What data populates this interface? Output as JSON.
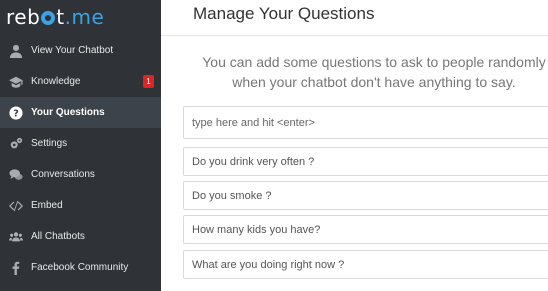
{
  "logo": {
    "part1": "reb",
    "part2": "t",
    "part3": ".me"
  },
  "sidebar": {
    "items": [
      {
        "label": "View Your Chatbot",
        "icon": "user-icon"
      },
      {
        "label": "Knowledge",
        "icon": "graduation-cap-icon",
        "badge": "1"
      },
      {
        "label": "Your Questions",
        "icon": "question-circle-icon",
        "active": true
      },
      {
        "label": "Settings",
        "icon": "gears-icon"
      },
      {
        "label": "Conversations",
        "icon": "chat-bubbles-icon"
      },
      {
        "label": "Embed",
        "icon": "code-icon"
      },
      {
        "label": "All Chatbots",
        "icon": "users-icon"
      },
      {
        "label": "Facebook Community",
        "icon": "facebook-icon"
      }
    ]
  },
  "main": {
    "title": "Manage Your Questions",
    "subtitle": "You can add some questions to ask to people randomly when your chatbot don't have anything to say.",
    "input_placeholder": "type here and hit <enter>",
    "questions": [
      "Do you drink very often ?",
      "Do you smoke ?",
      "How many kids you have?",
      "What are you doing right now ?"
    ]
  },
  "colors": {
    "sidebar_bg": "#2f3338",
    "active_bg": "#3d434a",
    "accent": "#3aa3e3",
    "badge": "#e02424"
  }
}
